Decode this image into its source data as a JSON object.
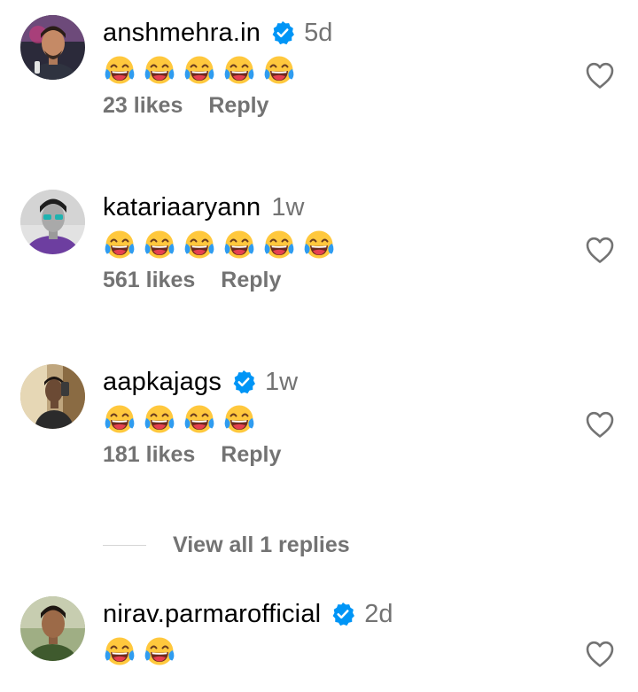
{
  "comments": [
    {
      "username": "anshmehra.in",
      "verified": true,
      "time": "5d",
      "emoji_count": 5,
      "likes": "23 likes",
      "reply": "Reply",
      "emoji_name": "face-with-tears-of-joy",
      "avatar_icon": "profile-photo"
    },
    {
      "username": "katariaaryann",
      "verified": false,
      "time": "1w",
      "emoji_count": 6,
      "likes": "561 likes",
      "reply": "Reply",
      "emoji_name": "face-with-tears-of-joy",
      "avatar_icon": "profile-photo"
    },
    {
      "username": "aapkajags",
      "verified": true,
      "time": "1w",
      "emoji_count": 4,
      "likes": "181 likes",
      "reply": "Reply",
      "emoji_name": "face-with-tears-of-joy",
      "avatar_icon": "profile-photo"
    },
    {
      "username": "nirav.parmarofficial",
      "verified": true,
      "time": "2d",
      "emoji_count": 2,
      "emoji_name": "face-with-tears-of-joy",
      "avatar_icon": "profile-photo"
    }
  ],
  "view_replies_label": "View all 1 replies",
  "colors": {
    "text_primary": "#000000",
    "text_secondary": "#737373",
    "verified_blue": "#0095f6",
    "divider": "#d6d6d6",
    "emoji_yellow": "#ffc83d",
    "tear_blue": "#2f9cf0"
  }
}
